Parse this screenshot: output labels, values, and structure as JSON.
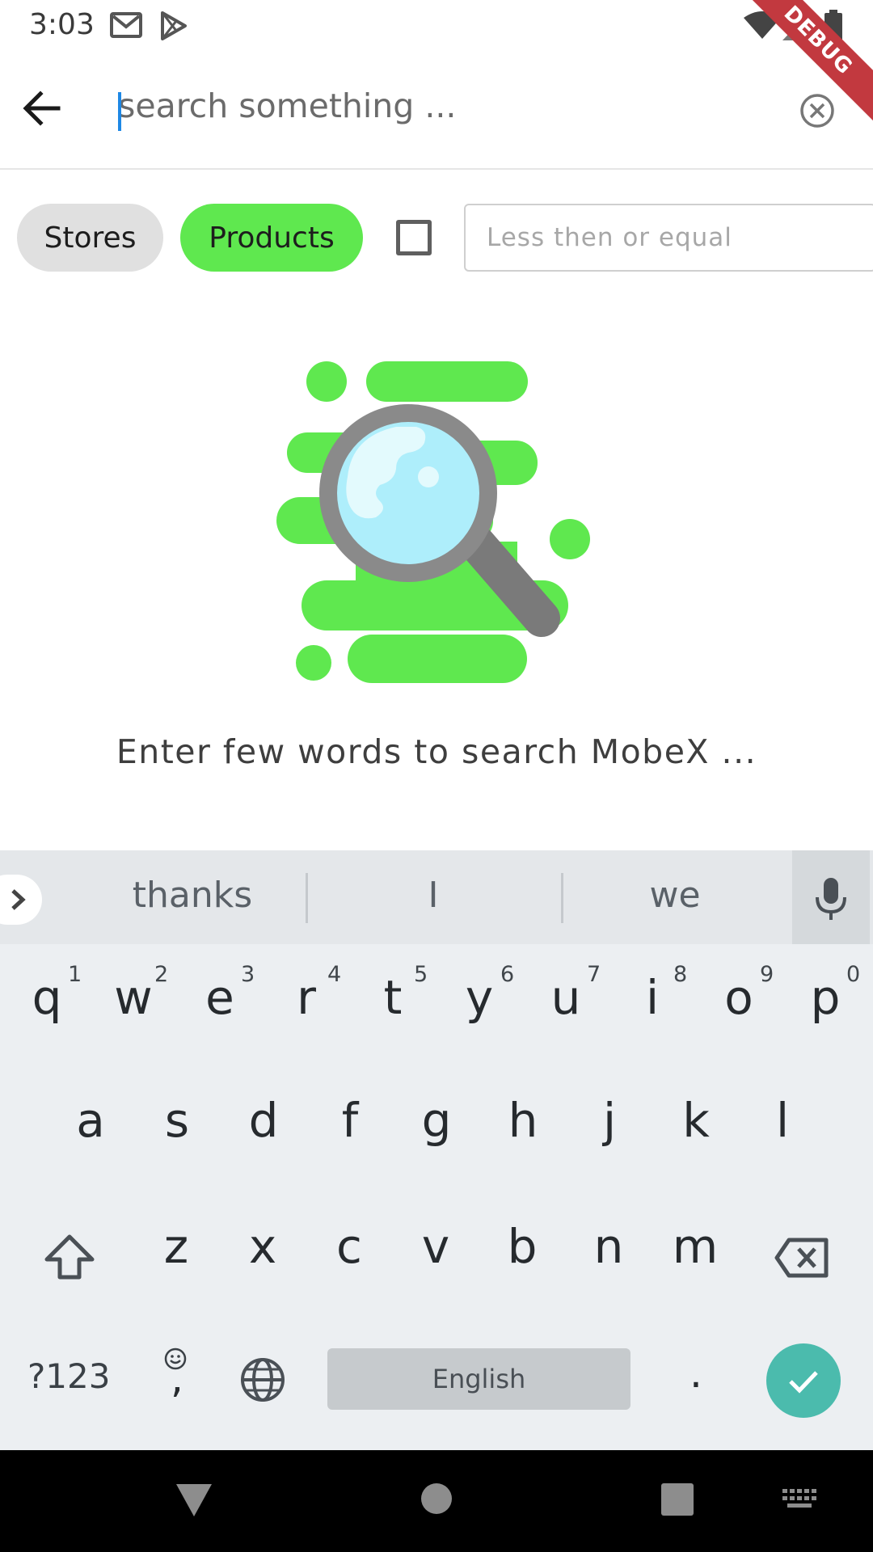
{
  "status_bar": {
    "time": "3:03",
    "icons": [
      "gmail-icon",
      "play-store-icon",
      "wifi-icon",
      "signal-icon",
      "battery-icon"
    ],
    "debug_banner": "DEBUG"
  },
  "app_bar": {
    "back_icon": "arrow-back-icon",
    "search_placeholder": "search something ...",
    "search_value": "",
    "clear_icon": "clear-circle-icon"
  },
  "filters": {
    "chips": [
      {
        "label": "Stores",
        "selected": false
      },
      {
        "label": "Products",
        "selected": true
      }
    ],
    "checkbox_checked": false,
    "price_placeholder": "Less then or equal"
  },
  "empty_state": {
    "illustration": "search-magnifier-illustration",
    "message": "Enter few words to search MobeX ..."
  },
  "keyboard": {
    "suggestions": [
      "thanks",
      "I",
      "we"
    ],
    "row1": [
      "q",
      "w",
      "e",
      "r",
      "t",
      "y",
      "u",
      "i",
      "o",
      "p"
    ],
    "row1_hints": [
      "1",
      "2",
      "3",
      "4",
      "5",
      "6",
      "7",
      "8",
      "9",
      "0"
    ],
    "row2": [
      "a",
      "s",
      "d",
      "f",
      "g",
      "h",
      "j",
      "k",
      "l"
    ],
    "row3": [
      "z",
      "x",
      "c",
      "v",
      "b",
      "n",
      "m"
    ],
    "symbols_label": "?123",
    "comma_label": ",",
    "space_label": "English",
    "period_label": "."
  },
  "colors": {
    "accent_green": "#5fe84f",
    "chip_gray": "#e0e0e0",
    "keyboard_enter": "#4bbbad",
    "cursor_blue": "#1e88e5",
    "debug_red": "#c2393f"
  }
}
